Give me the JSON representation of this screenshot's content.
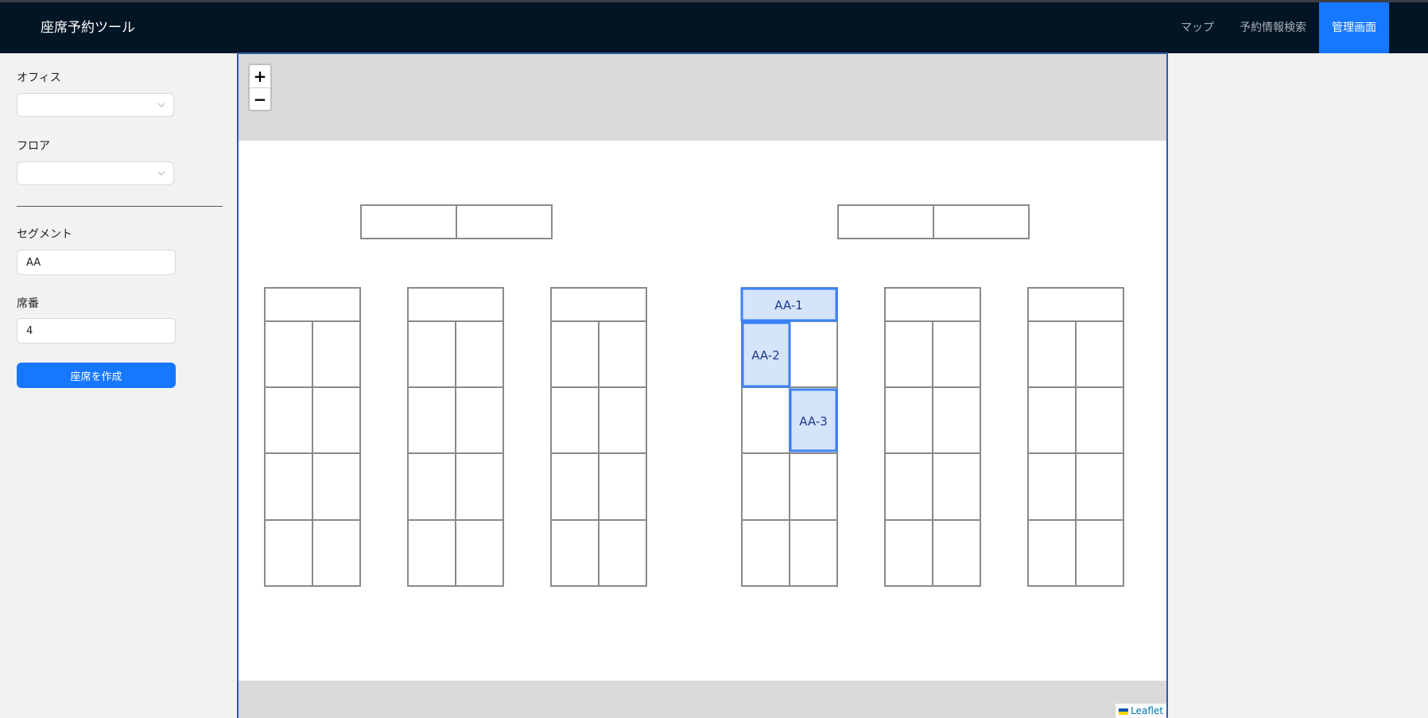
{
  "header": {
    "brand": "座席予約ツール",
    "nav": [
      {
        "label": "マップ",
        "active": false
      },
      {
        "label": "予約情報検索",
        "active": false
      },
      {
        "label": "管理画面",
        "active": true
      }
    ]
  },
  "sidebar": {
    "office_label": "オフィス",
    "office_value": "",
    "floor_label": "フロア",
    "floor_value": "",
    "segment_label": "セグメント",
    "segment_value": "AA",
    "seat_no_label": "席番",
    "seat_no_value": "4",
    "create_button": "座席を作成"
  },
  "map": {
    "zoom_in": "+",
    "zoom_out": "−",
    "attribution": "Leaflet",
    "selected_seats": [
      "AA-1",
      "AA-2",
      "AA-3"
    ]
  },
  "colors": {
    "accent": "#1677ff",
    "navbar": "#021525",
    "seat_fill": "#d6e4fa",
    "seat_border": "#3b82f6",
    "seat_label": "#1e3a8a"
  }
}
